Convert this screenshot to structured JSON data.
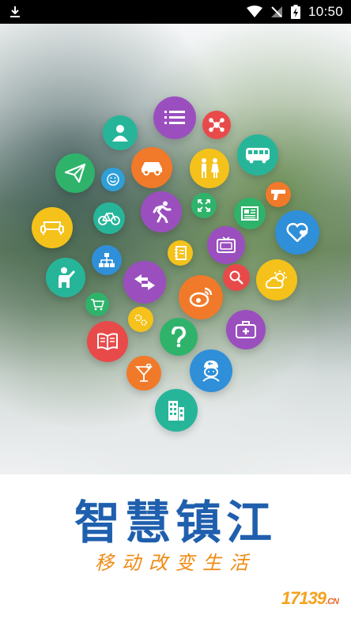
{
  "status_bar": {
    "time": "10:50",
    "icons": [
      "download-icon",
      "wifi-icon",
      "no-signal-icon",
      "battery-charging-icon"
    ]
  },
  "splash": {
    "bubbles": [
      {
        "name": "list-icon",
        "color": "#9b4fbf"
      },
      {
        "name": "user-icon",
        "color": "#27b59a"
      },
      {
        "name": "network-icon",
        "color": "#e84a4a"
      },
      {
        "name": "car-icon",
        "color": "#f07a2a"
      },
      {
        "name": "restroom-icon",
        "color": "#f4c21a"
      },
      {
        "name": "bus-icon",
        "color": "#27b59a"
      },
      {
        "name": "send-icon",
        "color": "#2fb36b"
      },
      {
        "name": "emoji-icon",
        "color": "#2f9fd8"
      },
      {
        "name": "gun-icon",
        "color": "#f07a2a"
      },
      {
        "name": "sofa-icon",
        "color": "#f4c21a"
      },
      {
        "name": "bicycle-icon",
        "color": "#27b59a"
      },
      {
        "name": "running-icon",
        "color": "#9b4fbf"
      },
      {
        "name": "fullscreen-icon",
        "color": "#2fb36b"
      },
      {
        "name": "newspaper-icon",
        "color": "#2fb36b"
      },
      {
        "name": "heart-icon",
        "color": "#2f8fd8"
      },
      {
        "name": "presenter-icon",
        "color": "#27b59a"
      },
      {
        "name": "org-chart-icon",
        "color": "#2f8fd8"
      },
      {
        "name": "transfer-icon",
        "color": "#9b4fbf"
      },
      {
        "name": "notebook-icon",
        "color": "#f4c21a"
      },
      {
        "name": "tv-icon",
        "color": "#9b4fbf"
      },
      {
        "name": "weather-icon",
        "color": "#f4c21a"
      },
      {
        "name": "cart-icon",
        "color": "#2fb36b"
      },
      {
        "name": "weibo-icon",
        "color": "#f07a2a"
      },
      {
        "name": "search-icon",
        "color": "#e84a4a"
      },
      {
        "name": "settings-icon",
        "color": "#f4c21a"
      },
      {
        "name": "book-icon",
        "color": "#e84a4a"
      },
      {
        "name": "help-icon",
        "color": "#2fb36b"
      },
      {
        "name": "medical-kit-icon",
        "color": "#9b4fbf"
      },
      {
        "name": "nurse-icon",
        "color": "#2f8fd8"
      },
      {
        "name": "cocktail-icon",
        "color": "#f07a2a"
      },
      {
        "name": "building-icon",
        "color": "#27b59a"
      }
    ]
  },
  "brand": {
    "title": "智慧镇江",
    "slogan": "移动改变生活",
    "watermark_main": "17139",
    "watermark_domain": ".CN"
  },
  "colors": {
    "brand_blue": "#1f5fae",
    "slogan_orange": "#f08a12"
  }
}
